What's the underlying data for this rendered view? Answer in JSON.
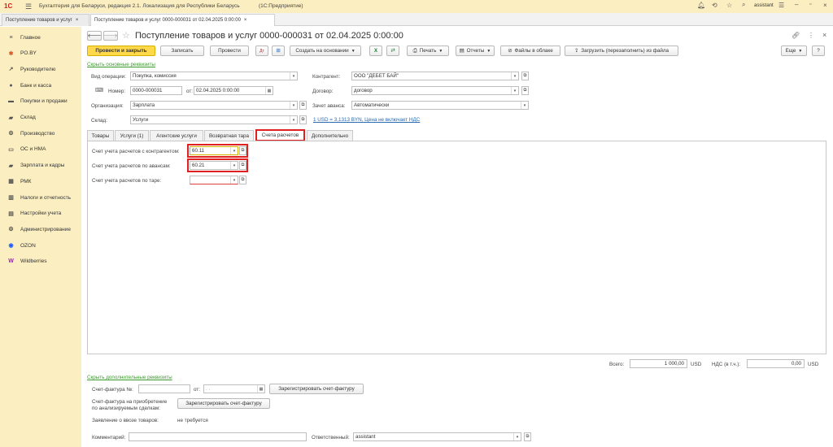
{
  "app": {
    "logo": "1С",
    "title": "Бухгалтерия для Беларуси, редакция 2.1. Локализация для Республики Беларусь",
    "platform": "(1С:Предприятие)",
    "user": "assistant"
  },
  "window_tabs": [
    {
      "label": "Поступление товаров и услуг",
      "close": "×"
    },
    {
      "label": "Поступление товаров и услуг 0000-000031 от 02.04.2025 0:00:00",
      "close": "×"
    }
  ],
  "sidebar": {
    "items": [
      {
        "label": "Главное",
        "icon": "menu-icon",
        "color": "#555555"
      },
      {
        "label": "PO.BY",
        "icon": "spark-icon",
        "color": "#e05a2a"
      },
      {
        "label": "Руководителю",
        "icon": "chart-icon",
        "color": "#555555"
      },
      {
        "label": "Банк и касса",
        "icon": "bank-icon",
        "color": "#555555"
      },
      {
        "label": "Покупки и продажи",
        "icon": "cart-icon",
        "color": "#555555"
      },
      {
        "label": "Склад",
        "icon": "warehouse-icon",
        "color": "#555555"
      },
      {
        "label": "Производство",
        "icon": "factory-icon",
        "color": "#555555"
      },
      {
        "label": "ОС и НМА",
        "icon": "assets-icon",
        "color": "#555555"
      },
      {
        "label": "Зарплата и кадры",
        "icon": "people-icon",
        "color": "#555555"
      },
      {
        "label": "РМК",
        "icon": "register-icon",
        "color": "#555555"
      },
      {
        "label": "Налоги и отчетность",
        "icon": "tax-icon",
        "color": "#555555"
      },
      {
        "label": "Настройки учета",
        "icon": "settings-doc-icon",
        "color": "#555555"
      },
      {
        "label": "Администрирование",
        "icon": "gear-icon",
        "color": "#555555"
      },
      {
        "label": "OZON",
        "icon": "ozon-icon",
        "color": "#1a5cff"
      },
      {
        "label": "Wildberries",
        "icon": "wildberries-icon",
        "color": "#9b1fb8"
      }
    ]
  },
  "doc": {
    "title": "Поступление товаров и услуг 0000-000031 от 02.04.2025 0:00:00",
    "toolbar": {
      "post_close": "Провести и закрыть",
      "save": "Записать",
      "post": "Провести",
      "create_based": "Создать на основании",
      "print": "Печать",
      "reports": "Отчеты",
      "files_cloud": "Файлы в облаке",
      "load_file": "Загрузить (перезаполнить) из файла",
      "more": "Еще"
    },
    "hide_main": "Скрыть основные реквизиты",
    "fields": {
      "operation_label": "Вид операции:",
      "operation_value": "Покупка, комиссия",
      "number_label": "Номер:",
      "number_value": "0000-000031",
      "date_from_label": "от:",
      "date_value": "02.04.2025  0:00:00",
      "org_label": "Организация:",
      "org_value": "Зарплата",
      "warehouse_label": "Склад:",
      "warehouse_value": "Услуги",
      "counterparty_label": "Контрагент:",
      "counterparty_value": "ООО \"ДЕБЕТ БАЙ\"",
      "contract_label": "Договор:",
      "contract_value": "договор",
      "advance_label": "Зачет аванса:",
      "advance_value": "Автоматически",
      "rate_link": "1 USD = 3,1313 BYN, Цена не включает НДС"
    },
    "form_tabs": [
      "Товары",
      "Услуги (1)",
      "Агентские услуги",
      "Возвратная тара",
      "Счета расчетов",
      "Дополнительно"
    ],
    "accounts": {
      "contractor_label": "Счет учета расчетов с контрагентом:",
      "contractor_value": "60.11",
      "advance_label": "Счет учета расчетов по авансам:",
      "advance_value": "60.21",
      "tare_label": "Счет учета расчетов по таре:",
      "tare_value": ""
    },
    "totals": {
      "total_label": "Всего:",
      "total_value": "1 000,00",
      "total_currency": "USD",
      "vat_label": "НДС (в т.ч.):",
      "vat_value": "0,00",
      "vat_currency": "USD"
    },
    "hide_extra": "Скрыть дополнительные реквизиты",
    "invoice": {
      "label": "Счет-фактура №:",
      "from_label": "от:",
      "date_placeholder": " .  .    ",
      "register_btn": "Зарегистрировать счет-фактуру",
      "acq_label": "Счет-фактура на приобретение по анализируемым сделкам:",
      "acq_btn": "Зарегистрировать счет-фактуру",
      "import_label": "Заявление о ввозе товаров:",
      "import_value": "не требуется"
    },
    "comment_label": "Комментарий:",
    "responsible_label": "Ответственный:",
    "responsible_value": "assistant"
  },
  "colors": {
    "accent": "#ffd94a",
    "sidebar_bg": "#fbeec1",
    "highlight": "#e02020",
    "link": "#2a6ab3"
  }
}
